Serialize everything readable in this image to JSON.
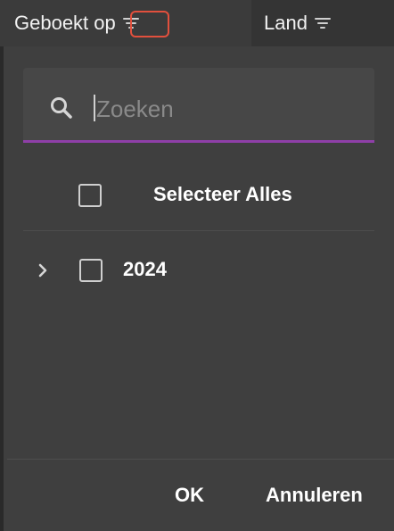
{
  "header": {
    "columns": [
      {
        "label": "Geboekt op",
        "icon": "filter-icon",
        "active": true
      },
      {
        "label": "Land",
        "icon": "filter-icon",
        "active": false
      }
    ]
  },
  "filter_menu": {
    "search": {
      "placeholder": "Zoeken",
      "value": "",
      "icon": "search-icon",
      "accent_color": "#8f3fa8"
    },
    "select_all_label": "Selecteer Alles",
    "tree_items": [
      {
        "label": "2024",
        "expandable": true,
        "checked": false
      }
    ],
    "buttons": {
      "ok_label": "OK",
      "cancel_label": "Annuleren"
    }
  },
  "colors": {
    "background": "#2b2b2b",
    "panel": "#3f3f3f",
    "highlight": "#e2503d"
  }
}
